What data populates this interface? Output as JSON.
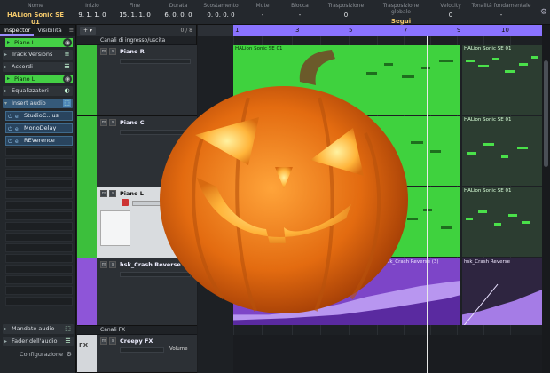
{
  "info_line": {
    "columns": [
      {
        "label": "Nome",
        "value": "HALion Sonic SE 01"
      },
      {
        "label": "Inizio",
        "value": "9. 1. 1.  0"
      },
      {
        "label": "Fine",
        "value": "15. 1. 1.  0"
      },
      {
        "label": "Durata",
        "value": "6. 0. 0.  0"
      },
      {
        "label": "Scostamento",
        "value": "0. 0. 0.  0"
      },
      {
        "label": "Mute",
        "value": "-"
      },
      {
        "label": "Blocca",
        "value": "-"
      },
      {
        "label": "Trasposizione",
        "value": "0"
      },
      {
        "label": "Trasposizione globale",
        "value": "Segui"
      },
      {
        "label": "Velocity",
        "value": "0"
      },
      {
        "label": "Tonalità fondamentale",
        "value": "-"
      }
    ]
  },
  "inspector": {
    "tabs": [
      "Inspector",
      "Visibilità"
    ],
    "track_name": "Piano L",
    "sections": {
      "track_versions": "Track Versions",
      "accordi": "Accordi",
      "equalizzatori": "Equalizzatori",
      "insert_audio": "Insert audio",
      "mandate_audio": "Mandate audio",
      "fader_audio": "Fader dell'audio",
      "configurazione": "Configurazione"
    },
    "inserts": [
      "StudioC...us",
      "MonoDelay",
      "REVerence"
    ],
    "insert_slot_name": "Piano L"
  },
  "tracklist": {
    "count": "0 / 8",
    "folder": "Canali di ingresso/uscita",
    "tracks": [
      {
        "name": "Piano R"
      },
      {
        "name": "Piano C"
      },
      {
        "name": "Piano L"
      },
      {
        "name": "hsk_Crash Reverse"
      },
      {
        "name": "Creepy FX"
      }
    ],
    "fx_folder": "Canali FX",
    "fx_label": "FX",
    "volume_label": "Volume"
  },
  "ruler": {
    "marks": [
      "1",
      "3",
      "5",
      "7",
      "9",
      "10"
    ]
  },
  "parts": {
    "midi_name": "HALion Sonic SE 01",
    "audio_name_a": "hsk_Crash Reverse (3)",
    "audio_name_b": "hsk_Crash Reverse"
  },
  "colors": {
    "midi": "#3fd23e",
    "audio": "#7d45c8",
    "ruler_range": "#8a73ff"
  }
}
